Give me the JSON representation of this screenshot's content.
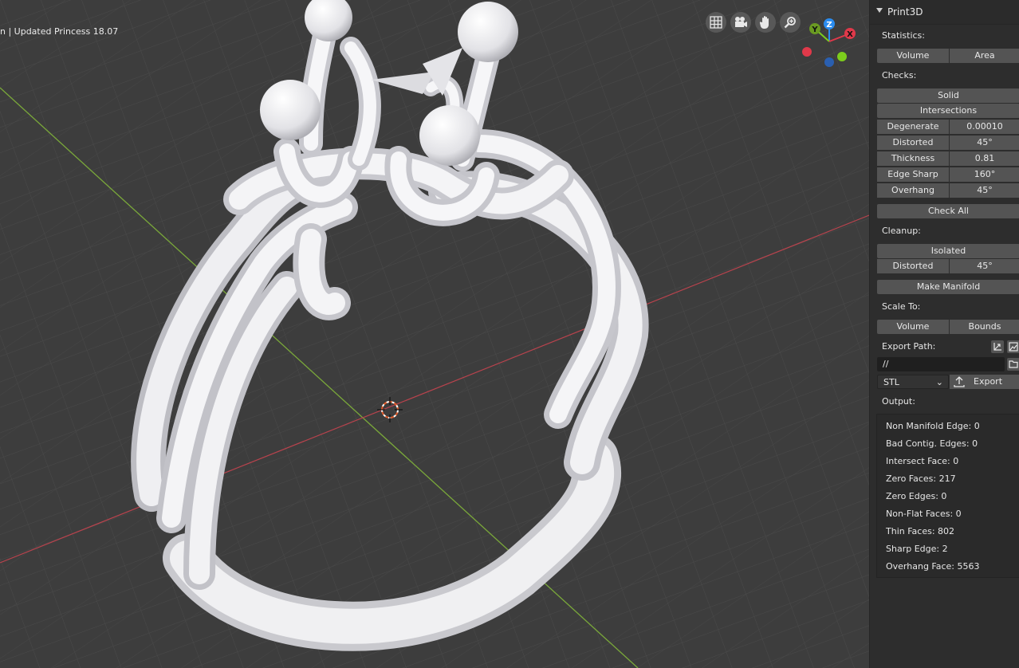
{
  "viewport": {
    "caption": "n | Updated Princess 18.07",
    "nav_icons": [
      "grid-icon",
      "camera-icon",
      "hand-icon",
      "zoom-icon"
    ],
    "axes": {
      "x_label": "X",
      "y_label": "Y",
      "z_label": "Z",
      "x_color": "#e0394a",
      "y_color": "#7ccc1c",
      "z_color": "#2a8cf0"
    }
  },
  "panel": {
    "title": "Print3D",
    "statistics_label": "Statistics:",
    "statistics_buttons": [
      "Volume",
      "Area"
    ],
    "checks_label": "Checks:",
    "solid_label": "Solid",
    "intersections_label": "Intersections",
    "checks": [
      {
        "label": "Degenerate",
        "value": "0.00010"
      },
      {
        "label": "Distorted",
        "value": "45°"
      },
      {
        "label": "Thickness",
        "value": "0.81"
      },
      {
        "label": "Edge Sharp",
        "value": "160°"
      },
      {
        "label": "Overhang",
        "value": "45°"
      }
    ],
    "check_all_label": "Check All",
    "cleanup_label": "Cleanup:",
    "isolated_label": "Isolated",
    "cleanup_distorted": {
      "label": "Distorted",
      "value": "45°"
    },
    "make_manifold_label": "Make Manifold",
    "scale_to_label": "Scale To:",
    "scale_buttons": [
      "Volume",
      "Bounds"
    ],
    "export_path_label": "Export Path:",
    "export_path_value": "//",
    "format_value": "STL",
    "export_label": "Export",
    "output_label": "Output:",
    "output_lines": [
      "Non Manifold Edge: 0",
      "Bad Contig. Edges: 0",
      "Intersect Face: 0",
      "Zero Faces: 217",
      "Zero Edges: 0",
      "Non-Flat Faces: 0",
      "Thin Faces: 802",
      "Sharp Edge: 2",
      "Overhang Face: 5563"
    ]
  }
}
